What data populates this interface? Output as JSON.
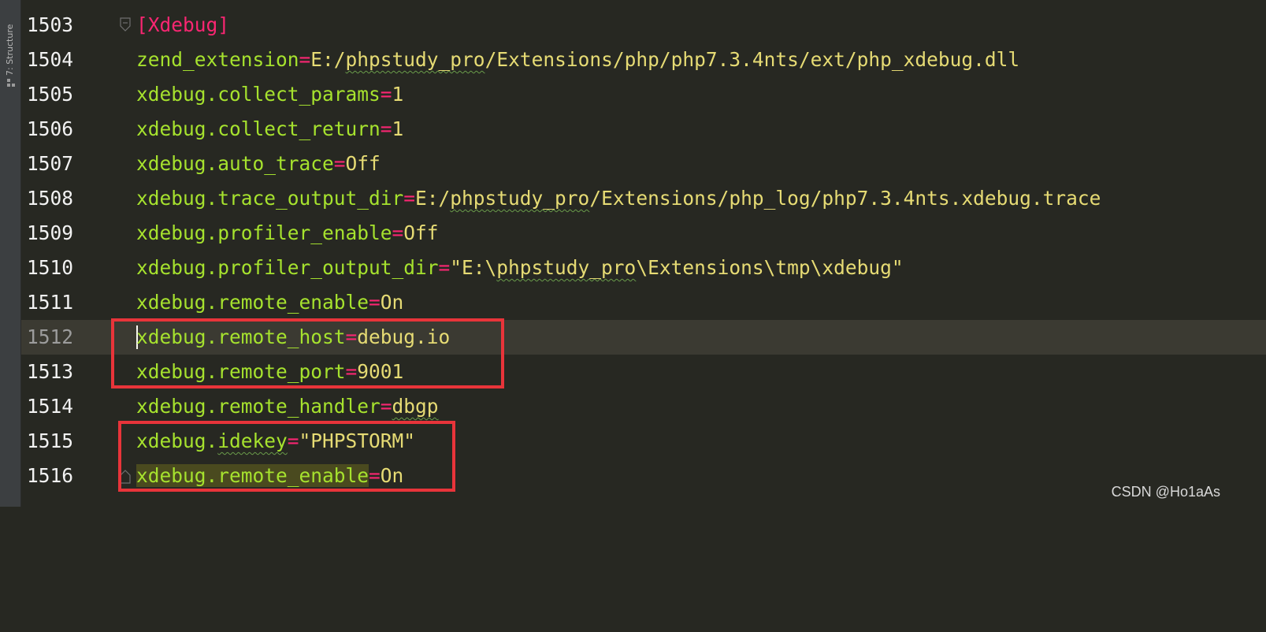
{
  "side_panel": {
    "structure_tab": "7: Structure"
  },
  "editor": {
    "lines": [
      {
        "num": "1503",
        "section": "[Xdebug]"
      },
      {
        "num": "1504",
        "key": "zend_extension",
        "eq": "=",
        "val_pre": "E:/",
        "val_sq": "phpstudy_pro",
        "val_post": "/Extensions/php/php7.3.4nts/ext/php_xdebug.dll"
      },
      {
        "num": "1505",
        "key": "xdebug.collect_params",
        "eq": "=",
        "val": "1"
      },
      {
        "num": "1506",
        "key": "xdebug.collect_return",
        "eq": "=",
        "val": "1"
      },
      {
        "num": "1507",
        "key": "xdebug.auto_trace",
        "eq": "=",
        "val": "Off"
      },
      {
        "num": "1508",
        "key": "xdebug.trace_output_dir",
        "eq": "=",
        "val_pre": "E:/",
        "val_sq": "phpstudy_pro",
        "val_post": "/Extensions/php_log/php7.3.4nts.xdebug.trace"
      },
      {
        "num": "1509",
        "key": "xdebug.profiler_enable",
        "eq": "=",
        "val": "Off"
      },
      {
        "num": "1510",
        "key": "xdebug.profiler_output_dir",
        "eq": "=",
        "val_pre": "\"E:\\",
        "val_sq": "phpstudy_pro",
        "val_post": "\\Extensions\\tmp\\xdebug\""
      },
      {
        "num": "1511",
        "key": "xdebug.remote_enable",
        "eq": "=",
        "val": "On"
      },
      {
        "num": "1512",
        "key": "xdebug.remote_host",
        "eq": "=",
        "val": "debug.io"
      },
      {
        "num": "1513",
        "key": "xdebug.remote_port",
        "eq": "=",
        "val": "9001"
      },
      {
        "num": "1514",
        "key": "xdebug.remote_handler",
        "eq": "=",
        "val_sq_only": "dbgp"
      },
      {
        "num": "1515",
        "key_pre": "xdebug.",
        "key_sq": "idekey",
        "eq": "=",
        "val": "\"PHPSTORM\""
      },
      {
        "num": "1516",
        "key": "xdebug.remote_enable",
        "eq": "=",
        "val": "On"
      }
    ]
  },
  "watermark": "CSDN @Ho1aAs",
  "colors": {
    "background": "#272822",
    "line_number": "#f2f2f2",
    "key": "#a6e22e",
    "operator": "#f92672",
    "value": "#e6db74",
    "current_line": "#3b3a32",
    "annotation_box": "#e8343a"
  }
}
